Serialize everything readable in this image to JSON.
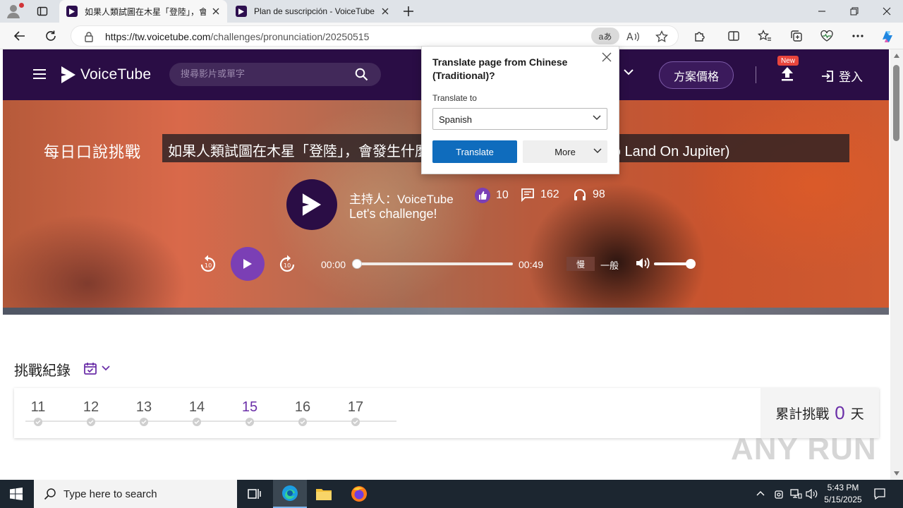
{
  "browser": {
    "tabs": [
      {
        "title": "如果人類試圖在木星「登陸」，會發生什麼事？",
        "active": true
      },
      {
        "title": "Plan de suscripción - VoiceTube Academy",
        "active": false
      }
    ],
    "url_domain": "https://tw.voicetube.com",
    "url_path": "/challenges/pronunciation/20250515",
    "translate_pill": "aあ"
  },
  "header": {
    "logo_text": "VoiceTube",
    "search_placeholder": "搜尋影片或單字",
    "plan_button": "方案價格",
    "new_badge": "New",
    "login": "登入"
  },
  "hero": {
    "label": "每日口說挑戰",
    "title": "如果人類試圖在木星「登陸」，會發生什麼事？ (What If Humans Tried To Land On Jupiter)",
    "host_name": "主持人：VoiceTube",
    "host_subtitle": "Let's challenge!",
    "likes": "10",
    "comments": "162",
    "listens": "98",
    "time_current": "00:00",
    "time_total": "00:49",
    "progress_fraction": 0,
    "speed_slow": "慢",
    "speed_normal": "一般",
    "volume_fraction": 1
  },
  "record": {
    "title": "挑戰紀錄",
    "days": [
      "11",
      "12",
      "13",
      "14",
      "15",
      "16",
      "17"
    ],
    "current_day": "15",
    "streak_label": "累計挑戰",
    "streak_count": "0",
    "streak_unit": "天"
  },
  "translate_popup": {
    "title": "Translate page from Chinese (Traditional)?",
    "to_label": "Translate to",
    "language": "Spanish",
    "translate_button": "Translate",
    "more_button": "More"
  },
  "watermark": "ANY RUN",
  "taskbar": {
    "search_placeholder": "Type here to search",
    "time": "5:43 PM",
    "date": "5/15/2025"
  },
  "colors": {
    "brand": "#2a0d45",
    "accent": "#7b3fb5",
    "edge_blue": "#0f6cbd"
  }
}
